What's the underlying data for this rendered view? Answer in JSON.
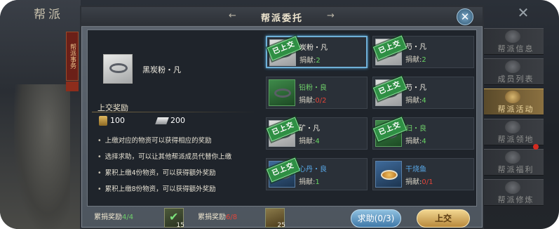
{
  "background": {
    "title": "帮派",
    "red_tab": "帮派事务"
  },
  "side_menu": [
    {
      "label": "帮派信息",
      "icon": "banner-icon",
      "active": false
    },
    {
      "label": "成员列表",
      "icon": "members-icon",
      "active": false
    },
    {
      "label": "帮派活动",
      "icon": "activity-icon",
      "active": true
    },
    {
      "label": "帮派领地",
      "icon": "territory-icon",
      "active": false
    },
    {
      "label": "帮派福利",
      "icon": "welfare-icon",
      "active": false
    },
    {
      "label": "帮派修炼",
      "icon": "training-icon",
      "active": false
    }
  ],
  "dialog": {
    "title": "帮派委托",
    "close": "✕"
  },
  "info": {
    "item_name": "黑炭粉・凡",
    "reward_title": "上交奖励",
    "reward_a": "100",
    "reward_b": "200",
    "bullets": [
      "上缴对应的物资可以获得相应的奖励",
      "选择求助，可以让其他帮派成员代替你上缴",
      "累积上缴4份物资，可以获得额外奖励",
      "累积上缴8份物资，可以获得额外奖励"
    ]
  },
  "grid": [
    {
      "name": "炭粉・凡",
      "contrib_label": "捐献:",
      "contrib": "2",
      "contrib_ok": true,
      "stamp": "已上交",
      "selected": true,
      "quality": "white"
    },
    {
      "name": "芍・凡",
      "contrib_label": "捐献:",
      "contrib": "2",
      "contrib_ok": true,
      "stamp": "已上交",
      "selected": false,
      "quality": "white"
    },
    {
      "name": "铅粉・良",
      "contrib_label": "捐献:",
      "contrib": "0/2",
      "contrib_ok": false,
      "stamp": "",
      "selected": false,
      "quality": "green"
    },
    {
      "name": "芍・凡",
      "contrib_label": "捐献:",
      "contrib": "4",
      "contrib_ok": true,
      "stamp": "已上交",
      "selected": false,
      "quality": "white"
    },
    {
      "name": "矿・凡",
      "contrib_label": "捐献:",
      "contrib": "4",
      "contrib_ok": true,
      "stamp": "已上交",
      "selected": false,
      "quality": "white"
    },
    {
      "name": "归・良",
      "contrib_label": "捐献:",
      "contrib": "4",
      "contrib_ok": true,
      "stamp": "已上交",
      "selected": false,
      "quality": "green"
    },
    {
      "name": "心丹・良",
      "contrib_label": "捐献:",
      "contrib": "1",
      "contrib_ok": true,
      "stamp": "已上交",
      "selected": false,
      "quality": "blue"
    },
    {
      "name": "干烧鱼",
      "contrib_label": "捐献:",
      "contrib": "0/1",
      "contrib_ok": false,
      "stamp": "",
      "selected": false,
      "quality": "blue"
    }
  ],
  "bottom": {
    "acc1_label": "累捐奖励",
    "acc1_value": "4/4",
    "acc1_count": "15",
    "acc2_label": "累捐奖励",
    "acc2_value": "6/8",
    "acc2_count": "25",
    "help_button": "求助(0/3)",
    "submit_button": "上交"
  },
  "colors": {
    "ok": "#68d462",
    "bad": "#e2453a",
    "stamp": "#2f8f44",
    "selected_border": "#6fb0d8"
  }
}
